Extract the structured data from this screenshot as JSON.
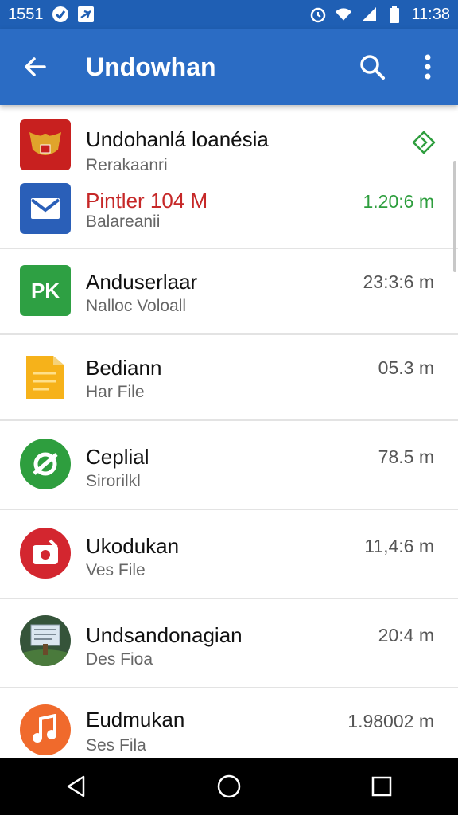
{
  "status_bar": {
    "left_text": "1551",
    "time": "11:38",
    "icons": [
      "check-circle-icon",
      "airplane-icon",
      "alarm-icon",
      "wifi-icon",
      "signal-icon",
      "battery-icon"
    ]
  },
  "app_bar": {
    "title": "Undowhan",
    "back_icon": "arrow-back-icon",
    "search_icon": "search-icon",
    "more_icon": "more-vert-icon"
  },
  "list": {
    "items": [
      {
        "name": "Undohanlá loanésia",
        "subtitle": "Rerakaanri",
        "size": "",
        "icon": "indonesia-emblem-icon",
        "action_icon": "install-chevron-icon"
      },
      {
        "name": "Pintler 104 M",
        "subtitle": "Balareanii",
        "size": "1.20:6 m",
        "icon": "mail-icon",
        "name_color": "#c62828",
        "size_color": "#2e9e3e"
      },
      {
        "name": "Anduserlaar",
        "subtitle": "Nalloc Voloall",
        "size": "23:3:6 m",
        "icon": "pk-app-icon"
      },
      {
        "name": "Bediann",
        "subtitle": "Har File",
        "size": "05.3 m",
        "icon": "document-icon"
      },
      {
        "name": "Ceplial",
        "subtitle": "Sirorilkl",
        "size": "78.5 m",
        "icon": "circle-app-icon"
      },
      {
        "name": "Ukodukan",
        "subtitle": "Ves File",
        "size": "11,4:6 m",
        "icon": "camera-app-icon"
      },
      {
        "name": "Undsandonagian",
        "subtitle": "Des Fioa",
        "size": "20:4 m",
        "icon": "landscape-app-icon"
      },
      {
        "name": "Eudmukan",
        "subtitle": "Ses Fila",
        "size": "1.98002 m",
        "icon": "music-note-icon"
      }
    ]
  },
  "nav_bar": {
    "back_icon": "nav-back-icon",
    "home_icon": "nav-home-icon",
    "recents_icon": "nav-recents-icon"
  },
  "colors": {
    "app_bar": "#2b6cc4",
    "status_bar": "#1f5fb4",
    "accent_red": "#c62828",
    "accent_green": "#2e9e3e"
  }
}
